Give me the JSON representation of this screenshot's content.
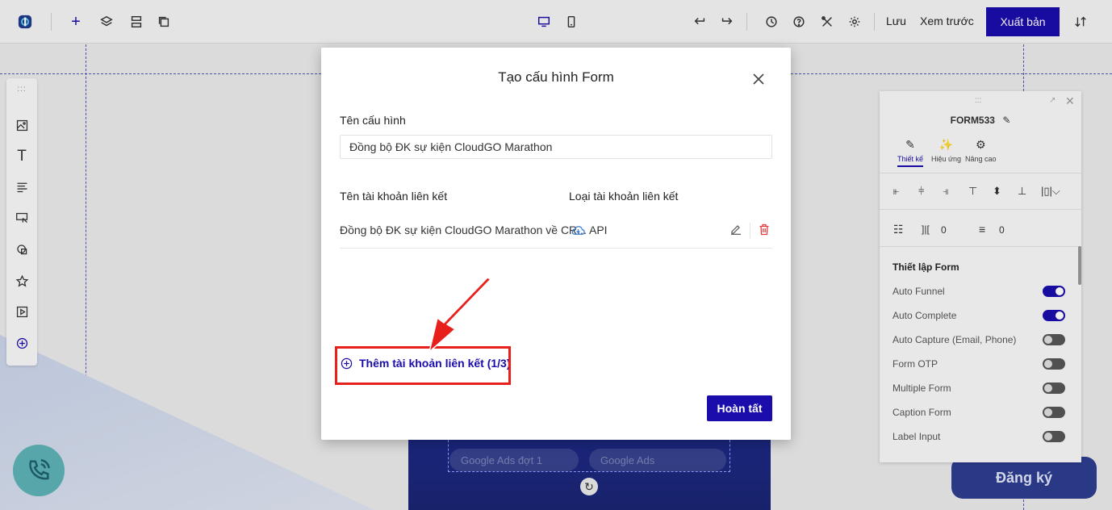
{
  "toolbar": {
    "save_label": "Lưu",
    "preview_label": "Xem trước",
    "publish_label": "Xuất bản"
  },
  "canvas": {
    "pill_1": "Google Ads đợt 1",
    "pill_2": "Google Ads",
    "register_label": "Đăng ký"
  },
  "right_panel": {
    "form_name": "FORM533",
    "tabs": [
      {
        "label": "Thiết kế"
      },
      {
        "label": "Hiệu ứng"
      },
      {
        "label": "Nâng cao"
      }
    ],
    "spacing_1": "0",
    "spacing_2": "0",
    "section_title": "Thiết lập Form",
    "settings": [
      {
        "label": "Auto Funnel",
        "on": true
      },
      {
        "label": "Auto Complete",
        "on": true
      },
      {
        "label": "Auto Capture (Email, Phone)",
        "on": false
      },
      {
        "label": "Form OTP",
        "on": false
      },
      {
        "label": "Multiple Form",
        "on": false
      },
      {
        "label": "Caption Form",
        "on": false
      },
      {
        "label": "Label Input",
        "on": false
      }
    ]
  },
  "modal": {
    "title": "Tạo cấu hình Form",
    "config_name_label": "Tên cấu hình",
    "config_name_value": "Đồng bộ ĐK sự kiện CloudGO Marathon",
    "account_name_header": "Tên tài khoản liên kết",
    "account_type_header": "Loại tài khoản liên kết",
    "accounts": [
      {
        "name": "Đồng bộ ĐK sự kiện CloudGO Marathon về CR...",
        "type": "API"
      }
    ],
    "add_link_label": "Thêm tài khoản liên kết (1/3)",
    "done_label": "Hoàn tất"
  },
  "colors": {
    "accent": "#1a0dab",
    "highlight": "#e8201c",
    "delete": "#e23b3b"
  }
}
